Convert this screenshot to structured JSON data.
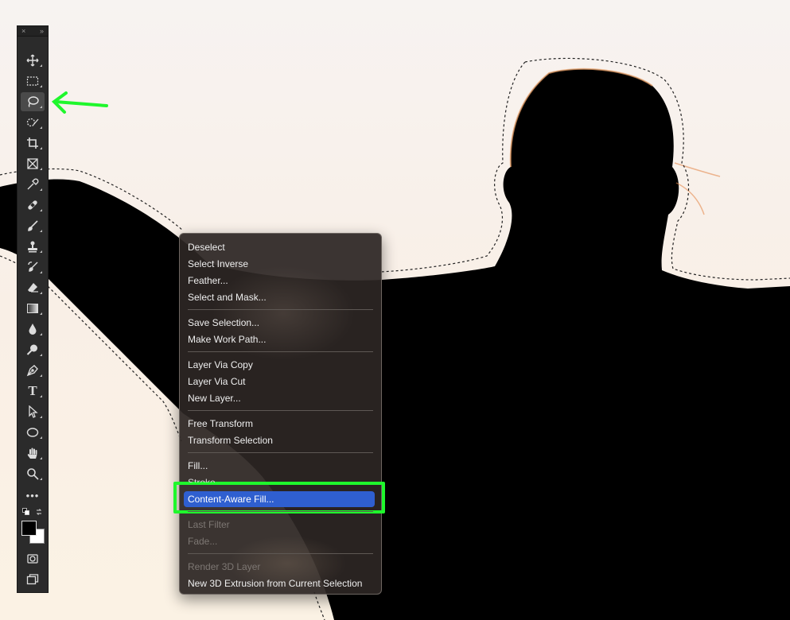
{
  "toolbar": {
    "collapse_icon": "×",
    "expand_icon": "»",
    "tools": [
      {
        "name": "move-tool",
        "icon": "move-icon"
      },
      {
        "name": "marquee-tool",
        "icon": "rect-marquee-icon"
      },
      {
        "name": "lasso-tool",
        "icon": "lasso-icon",
        "active": true
      },
      {
        "name": "quick-selection-tool",
        "icon": "quick-select-icon"
      },
      {
        "name": "crop-tool",
        "icon": "crop-icon"
      },
      {
        "name": "frame-tool",
        "icon": "frame-icon"
      },
      {
        "name": "eyedropper-tool",
        "icon": "eyedropper-icon"
      },
      {
        "name": "healing-tool",
        "icon": "bandage-icon"
      },
      {
        "name": "brush-tool",
        "icon": "brush-icon"
      },
      {
        "name": "stamp-tool",
        "icon": "stamp-icon"
      },
      {
        "name": "history-brush-tool",
        "icon": "history-brush-icon"
      },
      {
        "name": "eraser-tool",
        "icon": "eraser-icon"
      },
      {
        "name": "gradient-tool",
        "icon": "gradient-icon"
      },
      {
        "name": "blur-tool",
        "icon": "drop-icon"
      },
      {
        "name": "dodge-tool",
        "icon": "dodge-icon"
      },
      {
        "name": "pen-tool",
        "icon": "pen-icon"
      },
      {
        "name": "type-tool",
        "icon": "type-icon",
        "label": "T"
      },
      {
        "name": "path-selection-tool",
        "icon": "arrow-cursor-icon"
      },
      {
        "name": "ellipse-tool",
        "icon": "ellipse-icon"
      },
      {
        "name": "hand-tool",
        "icon": "hand-icon"
      },
      {
        "name": "zoom-tool",
        "icon": "zoom-icon"
      },
      {
        "name": "edit-toolbar",
        "icon": "more-icon",
        "label": "•••"
      }
    ],
    "colors": {
      "foreground": "#000000",
      "background": "#ffffff"
    }
  },
  "context_menu": {
    "groups": [
      [
        {
          "label": "Deselect",
          "enabled": true
        },
        {
          "label": "Select Inverse",
          "enabled": true
        },
        {
          "label": "Feather...",
          "enabled": true
        },
        {
          "label": "Select and Mask...",
          "enabled": true
        }
      ],
      [
        {
          "label": "Save Selection...",
          "enabled": true
        },
        {
          "label": "Make Work Path...",
          "enabled": true
        }
      ],
      [
        {
          "label": "Layer Via Copy",
          "enabled": true
        },
        {
          "label": "Layer Via Cut",
          "enabled": true
        },
        {
          "label": "New Layer...",
          "enabled": true
        }
      ],
      [
        {
          "label": "Free Transform",
          "enabled": true
        },
        {
          "label": "Transform Selection",
          "enabled": true
        }
      ],
      [
        {
          "label": "Fill...",
          "enabled": true
        },
        {
          "label": "Stroke...",
          "enabled": true
        },
        {
          "label": "Content-Aware Fill...",
          "enabled": true,
          "highlighted": true
        }
      ],
      [
        {
          "label": "Last Filter",
          "enabled": false
        },
        {
          "label": "Fade...",
          "enabled": false
        }
      ],
      [
        {
          "label": "Render 3D Layer",
          "enabled": false
        },
        {
          "label": "New 3D Extrusion from Current Selection",
          "enabled": true
        }
      ]
    ]
  },
  "annotations": {
    "arrow_color": "#1ff72c",
    "highlight_color": "#1ff72c"
  },
  "canvas": {
    "sky_color": "#f6f2ee",
    "silhouette_color": "#000000",
    "selection_outline": "marching-ants"
  }
}
